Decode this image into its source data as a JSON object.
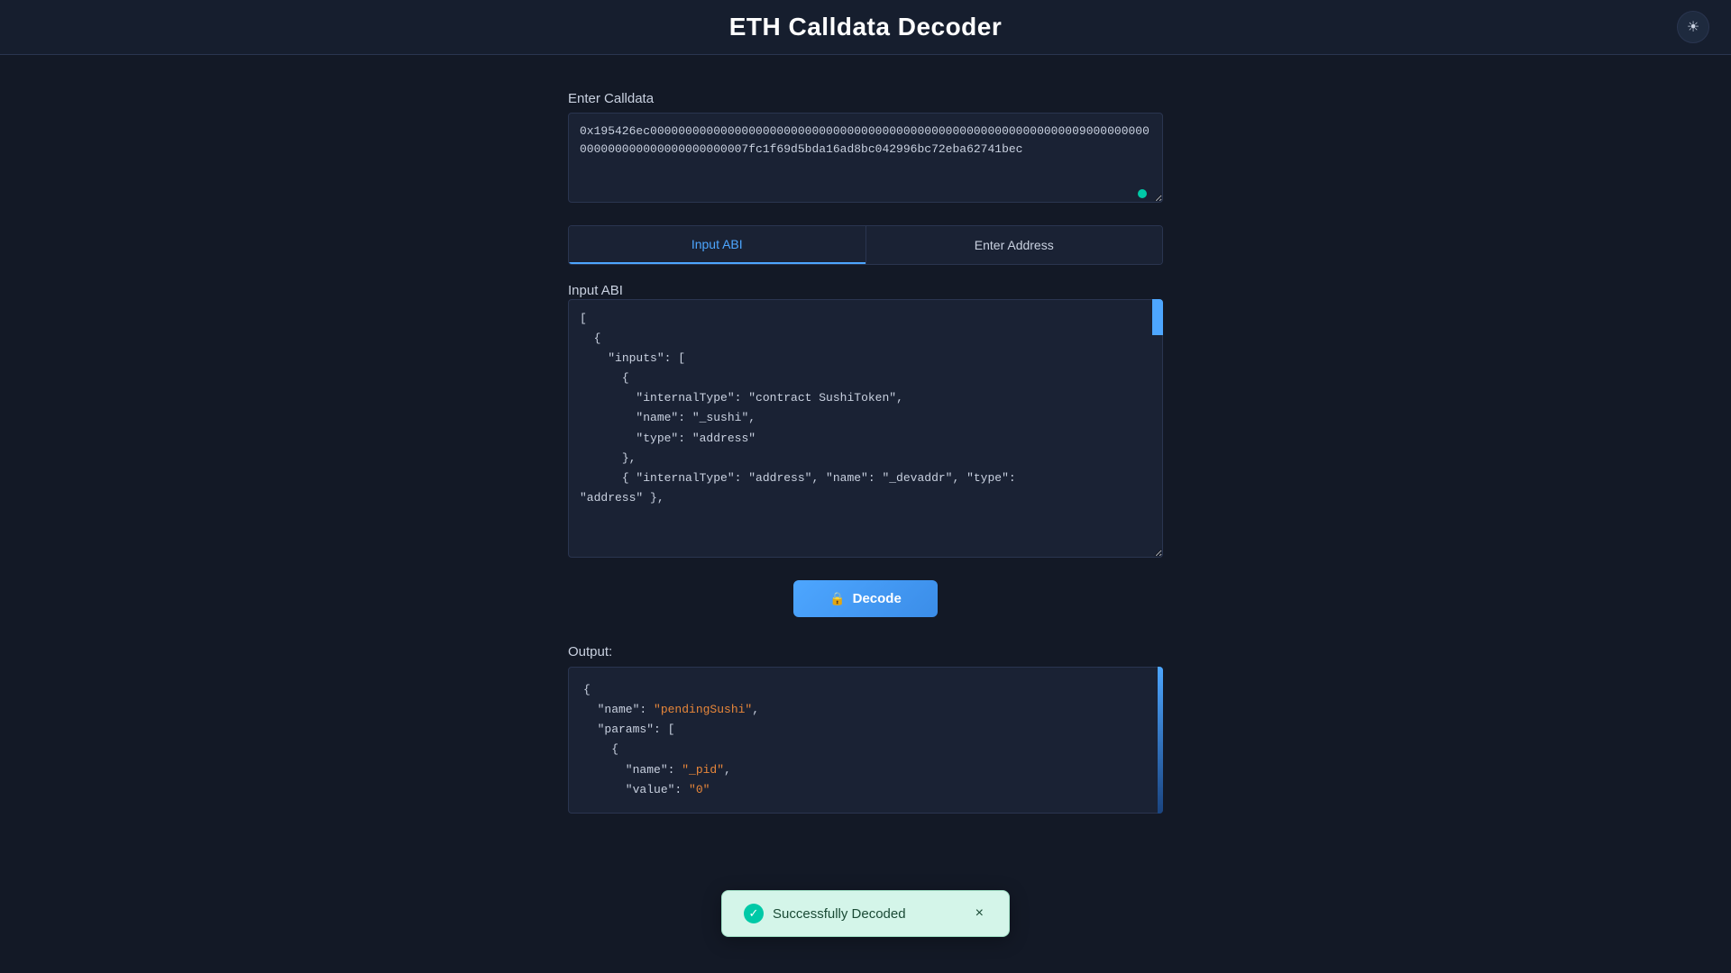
{
  "header": {
    "title": "ETH Calldata Decoder",
    "theme_icon": "☀"
  },
  "calldata_section": {
    "label": "Enter Calldata",
    "value": "0x195426ec00000000000000000000000000000000000000000000000000000000000009000000000000000000000000000000007fc1f69d5bda16ad8bc042996bc72eba62741bec"
  },
  "tabs": [
    {
      "label": "Input ABI",
      "active": true
    },
    {
      "label": "Enter Address",
      "active": false
    }
  ],
  "abi_section": {
    "label": "Input ABI",
    "value": "[\n  {\n    \"inputs\": [\n      {\n        \"internalType\": \"contract SushiToken\",\n        \"name\": \"_sushi\",\n        \"type\": \"address\"\n      },\n      { \"internalType\": \"address\", \"name\": \"_devaddr\", \"type\":\n\"address\" },"
  },
  "decode_button": {
    "label": "Decode",
    "icon": "🔒"
  },
  "output_section": {
    "label": "Output:",
    "value": "{\n  \"name\": \"pendingSushi\",\n  \"params\": [\n    {\n      \"name\": \"_pid\",\n      \"value\": \"0\""
  },
  "toast": {
    "message": "Successfully Decoded",
    "close_label": "×"
  }
}
